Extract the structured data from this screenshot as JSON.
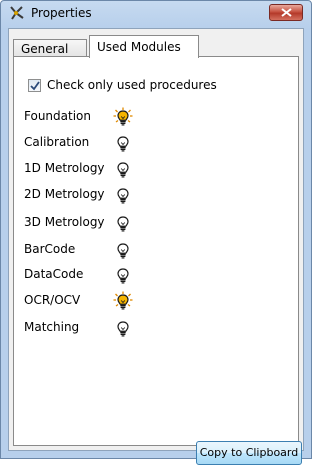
{
  "window": {
    "title": "Properties"
  },
  "tabs": [
    {
      "label": "General",
      "active": false
    },
    {
      "label": "Used Modules",
      "active": true
    }
  ],
  "options": {
    "check_only_used_label": "Check only used procedures",
    "check_only_used_checked": true
  },
  "modules": [
    {
      "name": "Foundation",
      "icon": "bulb-on-icon",
      "state": "on"
    },
    {
      "name": "Calibration",
      "icon": "bulb-off-icon",
      "state": "off"
    },
    {
      "name": "1D Metrology",
      "icon": "bulb-off-icon",
      "state": "off"
    },
    {
      "name": "2D Metrology",
      "icon": "bulb-off-icon",
      "state": "off"
    },
    {
      "name": "3D Metrology",
      "icon": "bulb-off-icon",
      "state": "off"
    },
    {
      "name": "BarCode",
      "icon": "bulb-off-icon",
      "state": "off"
    },
    {
      "name": "DataCode",
      "icon": "bulb-off-icon",
      "state": "off"
    },
    {
      "name": "OCR/OCV",
      "icon": "bulb-on-icon",
      "state": "on"
    },
    {
      "name": "Matching",
      "icon": "bulb-off-icon",
      "state": "off"
    }
  ],
  "actions": {
    "copy_label": "Copy to Clipboard"
  },
  "colors": {
    "bulb_on": "#f5b400",
    "bulb_off": "#ffffff",
    "close_button": "#c75342"
  }
}
